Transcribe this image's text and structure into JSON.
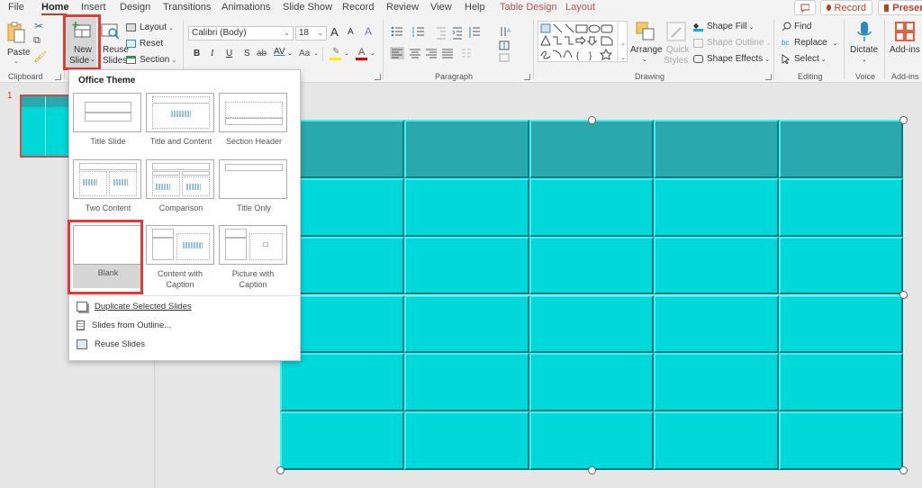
{
  "tabs": [
    {
      "label": "File",
      "active": false,
      "contextual": false
    },
    {
      "label": "Home",
      "active": true,
      "contextual": false
    },
    {
      "label": "Insert",
      "active": false,
      "contextual": false
    },
    {
      "label": "Design",
      "active": false,
      "contextual": false
    },
    {
      "label": "Transitions",
      "active": false,
      "contextual": false
    },
    {
      "label": "Animations",
      "active": false,
      "contextual": false
    },
    {
      "label": "Slide Show",
      "active": false,
      "contextual": false
    },
    {
      "label": "Record",
      "active": false,
      "contextual": false
    },
    {
      "label": "Review",
      "active": false,
      "contextual": false
    },
    {
      "label": "View",
      "active": false,
      "contextual": false
    },
    {
      "label": "Help",
      "active": false,
      "contextual": false
    },
    {
      "label": "Table Design",
      "active": false,
      "contextual": true
    },
    {
      "label": "Layout",
      "active": false,
      "contextual": true
    }
  ],
  "topright": {
    "comment_icon": "comment-icon",
    "record_label": "Record",
    "present_label": "Presen"
  },
  "ribbon": {
    "clipboard": {
      "paste_label": "Paste",
      "group_label": "Clipboard"
    },
    "slides": {
      "new_slide_line1": "New",
      "new_slide_line2": "Slide",
      "reuse_line1": "Reuse",
      "reuse_line2": "Slides",
      "layout_label": "Layout",
      "reset_label": "Reset",
      "section_label": "Section"
    },
    "font": {
      "font_name": "Calibri (Body)",
      "font_size": "18",
      "bold": "B",
      "italic": "I",
      "underline": "U",
      "shadow": "S",
      "strikethrough": "ab",
      "spacing": "AV",
      "change_case": "Aa",
      "grow": "A",
      "shrink": "A",
      "highlight_color": "#ffeb00",
      "font_color": "#e00000"
    },
    "paragraph": {
      "group_label": "Paragraph"
    },
    "drawing": {
      "arrange_label": "Arrange",
      "quick_styles_line1": "Quick",
      "quick_styles_line2": "Styles",
      "shape_fill": "Shape Fill",
      "shape_outline": "Shape Outline",
      "shape_effects": "Shape Effects",
      "group_label": "Drawing"
    },
    "editing": {
      "find": "Find",
      "replace": "Replace",
      "select": "Select",
      "group_label": "Editing"
    },
    "voice": {
      "dictate": "Dictate",
      "group_label": "Voice"
    },
    "addins": {
      "addins": "Add-ins",
      "group_label": "Add-ins"
    }
  },
  "thumbnails": {
    "slide_number": "1"
  },
  "new_slide_menu": {
    "header": "Office Theme",
    "layouts": [
      {
        "label": "Title Slide",
        "type": "title"
      },
      {
        "label": "Title and Content",
        "type": "title-content"
      },
      {
        "label": "Section Header",
        "type": "section"
      },
      {
        "label": "Two Content",
        "type": "two-content"
      },
      {
        "label": "Comparison",
        "type": "comparison"
      },
      {
        "label": "Title Only",
        "type": "title-only"
      },
      {
        "label": "Blank",
        "type": "blank",
        "highlighted": true
      },
      {
        "label": "Content with Caption",
        "type": "content-caption"
      },
      {
        "label": "Picture with Caption",
        "type": "picture-caption"
      }
    ],
    "actions": [
      {
        "label": "Duplicate Selected Slides",
        "icon": "duplicate-icon"
      },
      {
        "label": "Slides from Outline...",
        "icon": "outline-icon"
      },
      {
        "label": "Reuse Slides",
        "icon": "reuse-icon"
      }
    ]
  },
  "table": {
    "rows": 6,
    "columns": 5,
    "header_color": "#29a8ad",
    "body_color": "#00d8da"
  },
  "highlight_color": "#e53935"
}
